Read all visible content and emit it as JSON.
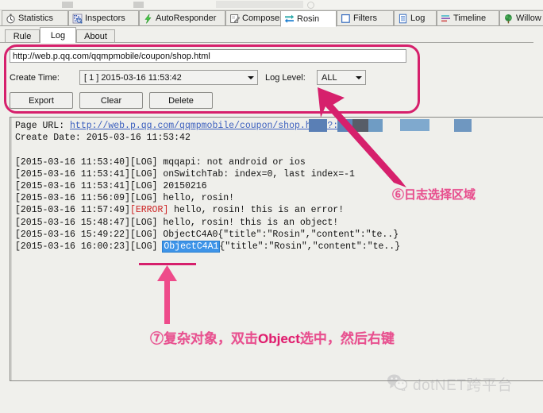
{
  "main_tabs": [
    {
      "label": "Statistics",
      "icon": "stopwatch-icon",
      "active": false
    },
    {
      "label": "Inspectors",
      "icon": "inspectors-icon",
      "active": false
    },
    {
      "label": "AutoResponder",
      "icon": "lightning-bolt-icon",
      "active": false
    },
    {
      "label": "Composer",
      "icon": "compose-pencil-icon",
      "active": false
    },
    {
      "label": "Rosin",
      "icon": "exchange-arrows-icon",
      "active": true
    },
    {
      "label": "Filters",
      "icon": "checkbox-icon",
      "active": false
    },
    {
      "label": "Log",
      "icon": "document-lines-icon",
      "active": false
    },
    {
      "label": "Timeline",
      "icon": "timeline-bars-icon",
      "active": false
    },
    {
      "label": "Willow",
      "icon": "tree-icon",
      "active": false
    }
  ],
  "sub_tabs": [
    {
      "label": "Rule",
      "active": false
    },
    {
      "label": "Log",
      "active": true
    },
    {
      "label": "About",
      "active": false
    }
  ],
  "controls": {
    "url_value": "http://web.p.qq.com/qqmpmobile/coupon/shop.html",
    "create_time_label": "Create Time:",
    "create_time_value": "[ 1 ] 2015-03-16 11:53:42",
    "log_level_label": "Log Level:",
    "log_level_value": "ALL",
    "buttons": [
      {
        "label": "Export"
      },
      {
        "label": "Clear"
      },
      {
        "label": "Delete"
      }
    ]
  },
  "log": {
    "page_url_label": "Page URL:",
    "page_url_link": "http://web.p.qq.com/qqmpmobile/coupon/shop.html?:",
    "create_date_label": "Create Date:",
    "create_date_value": "2015-03-16 11:53:42",
    "entries": [
      {
        "timestamp": "[2015-03-16 11:53:40]",
        "level": "[LOG]",
        "message": "mqqapi: not android or ios"
      },
      {
        "timestamp": "[2015-03-16 11:53:41]",
        "level": "[LOG]",
        "message": "onSwitchTab: index=0, last index=-1"
      },
      {
        "timestamp": "[2015-03-16 11:53:41]",
        "level": "[LOG]",
        "message": "20150216"
      },
      {
        "timestamp": "[2015-03-16 11:56:09]",
        "level": "[LOG]",
        "message": "hello, rosin!"
      },
      {
        "timestamp": "[2015-03-16 11:57:49]",
        "level": "[ERROR]",
        "message": "hello, rosin! this is an error!"
      },
      {
        "timestamp": "[2015-03-16 15:48:47]",
        "level": "[LOG]",
        "message": "hello, rosin! this is an object!"
      },
      {
        "timestamp": "[2015-03-16 15:49:22]",
        "level": "[LOG]",
        "object_token": "ObjectC4A0",
        "selected": false,
        "message": "{\"title\":\"Rosin\",\"content\":\"te..}"
      },
      {
        "timestamp": "[2015-03-16 16:00:23]",
        "level": "[LOG]",
        "object_token": "ObjectC4A1",
        "selected": true,
        "message": "{\"title\":\"Rosin\",\"content\":\"te..}"
      }
    ]
  },
  "annotations": {
    "note6": "⑥日志选择区域",
    "note7_part1": "⑦复杂对象，双击",
    "note7_bold": "Object",
    "note7_part2": "选中，然后右键"
  },
  "watermark": {
    "text": "dotNET跨平台",
    "icon": "wechat-icon"
  },
  "colors": {
    "annotation_pink": "#e8508f",
    "highlight_border": "#d6206c",
    "selection_blue": "#3e94e8",
    "error_red": "#cc2222",
    "link_blue": "#3b5fbe"
  }
}
